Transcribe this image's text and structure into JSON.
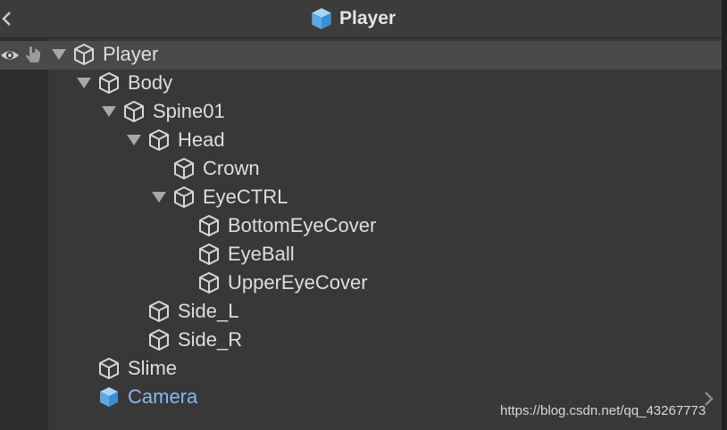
{
  "header": {
    "title": "Player",
    "back_icon": "chevron-left-icon",
    "prefab_icon": "prefab-cube-icon"
  },
  "toolbar_icons": {
    "visibility": "eye-icon",
    "pickability": "hand-pointer-icon"
  },
  "hierarchy": {
    "items": [
      {
        "label": "Player",
        "depth": 0,
        "expanded": true,
        "selected": true
      },
      {
        "label": "Body",
        "depth": 1,
        "expanded": true
      },
      {
        "label": "Spine01",
        "depth": 2,
        "expanded": true
      },
      {
        "label": "Head",
        "depth": 3,
        "expanded": true
      },
      {
        "label": "Crown",
        "depth": 4,
        "expanded": false
      },
      {
        "label": "EyeCTRL",
        "depth": 4,
        "expanded": true
      },
      {
        "label": "BottomEyeCover",
        "depth": 5,
        "expanded": false
      },
      {
        "label": "EyeBall",
        "depth": 5,
        "expanded": false
      },
      {
        "label": "UpperEyeCover",
        "depth": 5,
        "expanded": false
      },
      {
        "label": "Side_L",
        "depth": 3,
        "expanded": false
      },
      {
        "label": "Side_R",
        "depth": 3,
        "expanded": false
      },
      {
        "label": "Slime",
        "depth": 1,
        "expanded": false
      },
      {
        "label": "Camera",
        "depth": 1,
        "expanded": false,
        "prefab": true
      }
    ]
  },
  "colors": {
    "prefab_blue": "#6ab4ea",
    "camera_text": "#8ab6f2"
  },
  "watermark": "https://blog.csdn.net/qq_43267773"
}
